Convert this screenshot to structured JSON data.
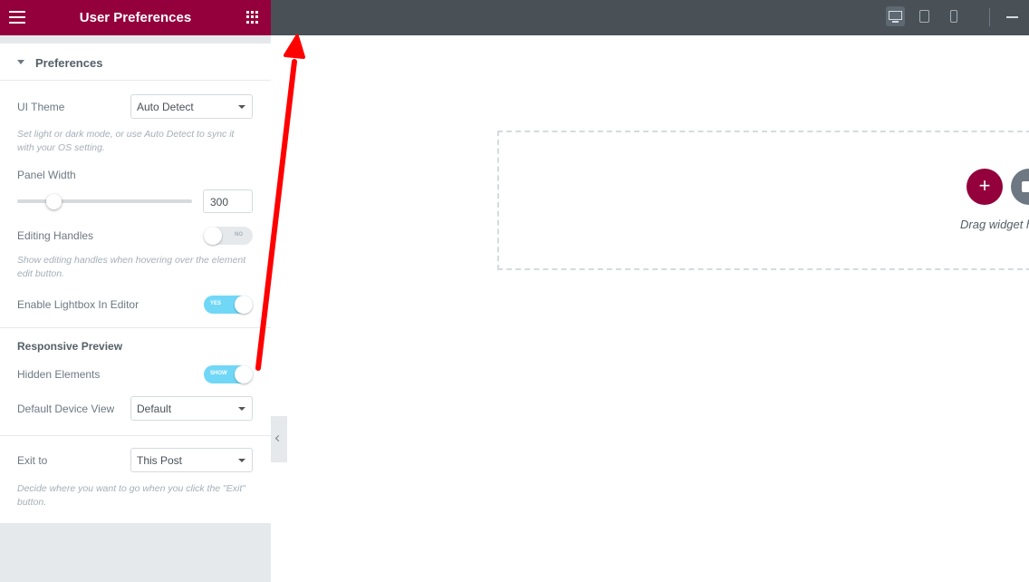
{
  "header": {
    "title": "User Preferences",
    "menu_icon": "hamburger-icon",
    "apps_icon": "grid-icon"
  },
  "colors": {
    "brand": "#93003c",
    "topbar": "#495157",
    "toggle_on": "#71d7f7",
    "annotation_arrow": "#ff0000"
  },
  "section": {
    "label": "Preferences"
  },
  "ui_theme": {
    "label": "UI Theme",
    "value": "Auto Detect",
    "description": "Set light or dark mode, or use Auto Detect to sync it with your OS setting."
  },
  "panel_width": {
    "label": "Panel Width",
    "value": "300",
    "slider_fraction": 0.21
  },
  "editing_handles": {
    "label": "Editing Handles",
    "state": "NO",
    "description": "Show editing handles when hovering over the element edit button."
  },
  "lightbox": {
    "label": "Enable Lightbox In Editor",
    "state": "YES"
  },
  "responsive": {
    "heading": "Responsive Preview"
  },
  "hidden_elements": {
    "label": "Hidden Elements",
    "state": "SHOW"
  },
  "default_device": {
    "label": "Default Device View",
    "value": "Default"
  },
  "exit_to": {
    "label": "Exit to",
    "value": "This Post",
    "description": "Decide where you want to go when you click the \"Exit\" button."
  },
  "topbar": {
    "devices": [
      "desktop-icon",
      "tablet-icon",
      "mobile-icon"
    ],
    "active_device": "desktop"
  },
  "canvas": {
    "drag_text": "Drag widget h"
  }
}
